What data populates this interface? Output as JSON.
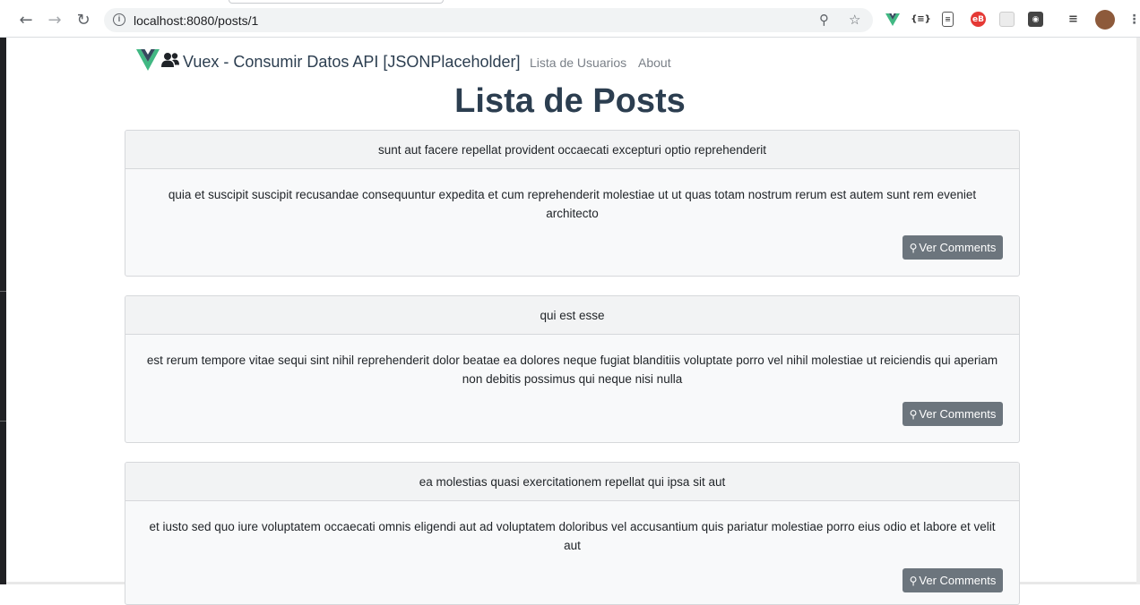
{
  "browser": {
    "url": "localhost:8080/posts/1",
    "back_icon": "arrow-left-icon",
    "forward_icon": "arrow-right-icon",
    "reload_icon": "reload-icon"
  },
  "navbar": {
    "brand_text": "Vuex - Consumir Datos API [JSONPlaceholder]",
    "links": [
      "Lista de Usuarios",
      "About"
    ]
  },
  "page": {
    "title": "Lista de Posts"
  },
  "posts": [
    {
      "title": "sunt aut facere repellat provident occaecati excepturi optio reprehenderit",
      "body": "quia et suscipit suscipit recusandae consequuntur expedita et cum reprehenderit molestiae ut ut quas totam nostrum rerum est autem sunt rem eveniet architecto",
      "button": "Ver Comments"
    },
    {
      "title": "qui est esse",
      "body": "est rerum tempore vitae sequi sint nihil reprehenderit dolor beatae ea dolores neque fugiat blanditiis voluptate porro vel nihil molestiae ut reiciendis qui aperiam non debitis possimus qui neque nisi nulla",
      "button": "Ver Comments"
    },
    {
      "title": "ea molestias quasi exercitationem repellat qui ipsa sit aut",
      "body": "et iusto sed quo iure voluptatem occaecati omnis eligendi aut ad voluptatem doloribus vel accusantium quis pariatur molestiae porro eius odio et labore et velit aut",
      "button": "Ver Comments"
    }
  ],
  "colors": {
    "vue_green": "#41b883",
    "vue_dark": "#35495e",
    "button_gray": "#6c757d",
    "title_color": "#2c3e50"
  }
}
